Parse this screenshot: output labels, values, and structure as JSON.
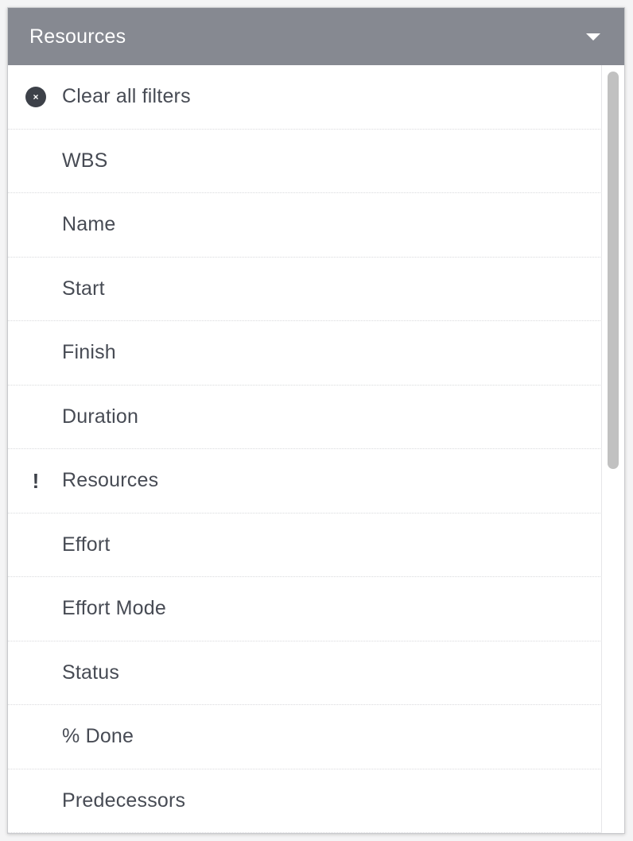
{
  "header": {
    "title": "Resources",
    "dropdown_icon": "caret-down-icon"
  },
  "menu": {
    "items": [
      {
        "label": "Clear all filters",
        "icon": "clear-circle-x-icon",
        "icon_glyph": "×"
      },
      {
        "label": "WBS"
      },
      {
        "label": "Name"
      },
      {
        "label": "Start"
      },
      {
        "label": "Finish"
      },
      {
        "label": "Duration"
      },
      {
        "label": "Resources",
        "icon": "exclamation-icon",
        "icon_glyph": "!"
      },
      {
        "label": "Effort"
      },
      {
        "label": "Effort Mode"
      },
      {
        "label": "Status"
      },
      {
        "label": "% Done"
      },
      {
        "label": "Predecessors"
      }
    ]
  },
  "colors": {
    "header_bg": "#868991",
    "header_text": "#ffffff",
    "item_text": "#474b54",
    "icon": "#3d4149",
    "scrollbar_thumb": "#c1c1c1"
  }
}
